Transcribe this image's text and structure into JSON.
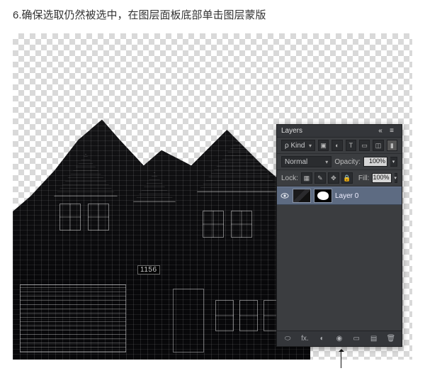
{
  "caption": "6.确保选取仍然被选中，在图层面板底部单击图层蒙版",
  "house": {
    "number": "1156"
  },
  "layers_panel": {
    "title": "Layers",
    "filter_label": "ρ Kind",
    "blend_mode": "Normal",
    "opacity_label": "Opacity:",
    "opacity_value": "100%",
    "lock_label": "Lock:",
    "fill_label": "Fill:",
    "fill_value": "100%",
    "layer0_name": "Layer 0",
    "filter_icons": {
      "image": "▣",
      "adjust": "◐",
      "type": "T",
      "shape": "▭",
      "smart": "◫"
    },
    "lock_icons": {
      "transparency": "▦",
      "paint": "✎",
      "position": "✥",
      "all": "🔒"
    },
    "footer": {
      "link": "⬭",
      "fx": "fx.",
      "mask": "◐",
      "adjust": "◉",
      "group": "▭",
      "new": "▤",
      "trash": "🗑"
    }
  }
}
